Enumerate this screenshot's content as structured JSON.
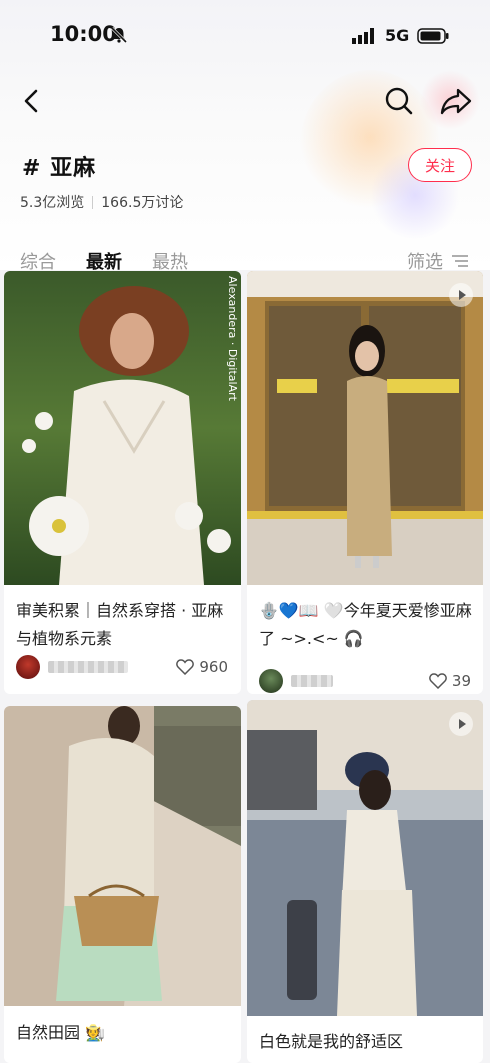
{
  "status_bar": {
    "time": "10:00",
    "network": "5G"
  },
  "topic": {
    "title": "# 亚麻",
    "follow_label": "关注",
    "views": "5.3亿浏览",
    "discussions": "166.5万讨论"
  },
  "tabs": [
    {
      "label": "综合",
      "active": false
    },
    {
      "label": "最新",
      "active": true
    },
    {
      "label": "最热",
      "active": false
    }
  ],
  "filter_label": "筛选",
  "image_watermark": "Alexandera · DigitalArt",
  "cards": [
    {
      "title": "审美积累｜自然系穿搭 · 亚麻与植物系元素",
      "likes": "960",
      "has_video": false
    },
    {
      "title": "🪬💙📖 🤍今年夏天爱惨亚麻了 ~>.<~ 🎧",
      "likes": "39",
      "has_video": true
    },
    {
      "title": "自然田园 🧑‍🌾",
      "likes": "",
      "has_video": false
    },
    {
      "title": "白色就是我的舒适区",
      "likes": "",
      "has_video": true
    }
  ],
  "colors": {
    "accent": "#ff2e4d"
  }
}
